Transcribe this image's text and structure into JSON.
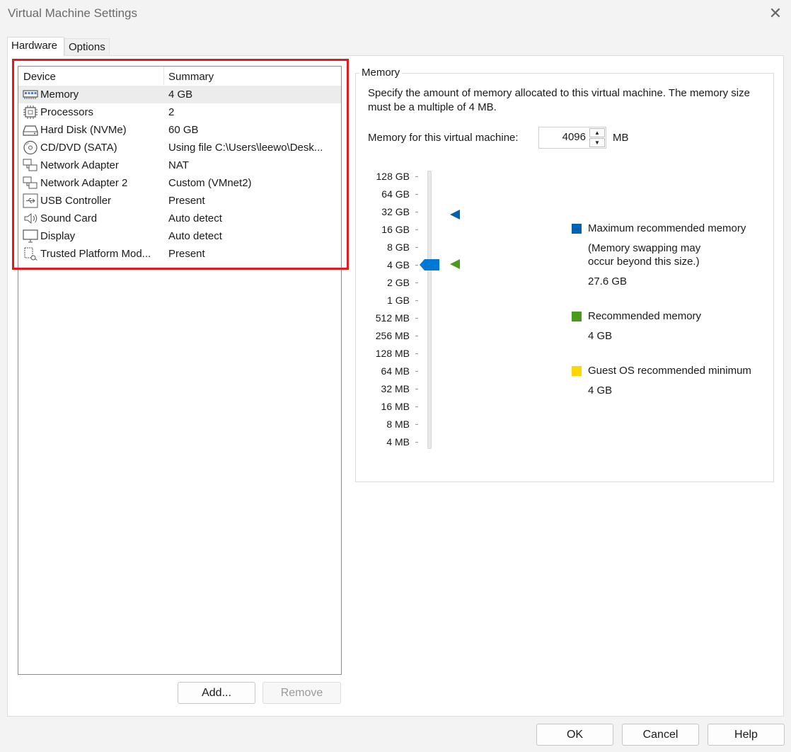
{
  "window": {
    "title": "Virtual Machine Settings",
    "close_glyph": "✕"
  },
  "tabs": [
    {
      "label": "Hardware"
    },
    {
      "label": "Options"
    }
  ],
  "device_list": {
    "columns": {
      "device": "Device",
      "summary": "Summary"
    },
    "rows": [
      {
        "name": "Memory",
        "summary": "4 GB",
        "icon": "memory-icon"
      },
      {
        "name": "Processors",
        "summary": "2",
        "icon": "processor-icon"
      },
      {
        "name": "Hard Disk (NVMe)",
        "summary": "60 GB",
        "icon": "hard-disk-icon"
      },
      {
        "name": "CD/DVD (SATA)",
        "summary": "Using file C:\\Users\\leewo\\Desk...",
        "icon": "cd-dvd-icon"
      },
      {
        "name": "Network Adapter",
        "summary": "NAT",
        "icon": "network-adapter-icon"
      },
      {
        "name": "Network Adapter 2",
        "summary": "Custom (VMnet2)",
        "icon": "network-adapter-icon"
      },
      {
        "name": "USB Controller",
        "summary": "Present",
        "icon": "usb-icon"
      },
      {
        "name": "Sound Card",
        "summary": "Auto detect",
        "icon": "speaker-icon"
      },
      {
        "name": "Display",
        "summary": "Auto detect",
        "icon": "monitor-icon"
      },
      {
        "name": "Trusted Platform Mod...",
        "summary": "Present",
        "icon": "tpm-icon"
      }
    ],
    "selected_index": 0
  },
  "list_buttons": {
    "add": "Add...",
    "remove": "Remove"
  },
  "memory_panel": {
    "group_title": "Memory",
    "description": "Specify the amount of memory allocated to this virtual machine. The memory size must be a multiple of 4 MB.",
    "field_label": "Memory for this virtual machine:",
    "field_value": "4096",
    "unit": "MB",
    "scale_labels": [
      "128 GB",
      "64 GB",
      "32 GB",
      "16 GB",
      "8 GB",
      "4 GB",
      "2 GB",
      "1 GB",
      "512 MB",
      "256 MB",
      "128 MB",
      "64 MB",
      "32 MB",
      "16 MB",
      "8 MB",
      "4 MB"
    ],
    "legend": {
      "max": {
        "label": "Maximum recommended memory",
        "note_line1": "(Memory swapping may",
        "note_line2": "occur beyond this size.)",
        "value": "27.6 GB",
        "color": "#0063b1"
      },
      "recommended": {
        "label": "Recommended memory",
        "value": "4 GB",
        "color": "#4a9a1c"
      },
      "guest_min": {
        "label": "Guest OS recommended minimum",
        "value": "4 GB",
        "color": "#ffd700"
      }
    },
    "slider_color": "#0078d4"
  },
  "footer_buttons": {
    "ok": "OK",
    "cancel": "Cancel",
    "help": "Help"
  }
}
